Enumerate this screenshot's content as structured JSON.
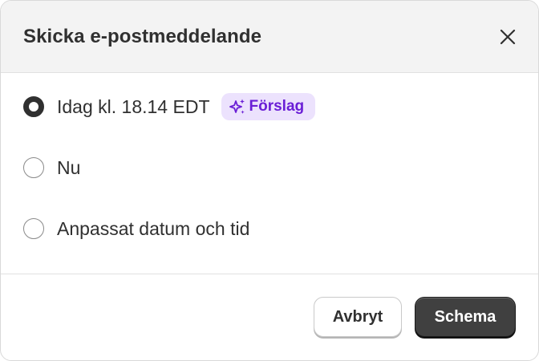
{
  "dialog": {
    "title": "Skicka e-postmeddelande",
    "close_icon": "close-icon"
  },
  "options": [
    {
      "label": "Idag kl. 18.14 EDT",
      "selected": true,
      "badge": {
        "label": "Förslag",
        "icon": "sparkle-icon",
        "color": "#6a1ed6",
        "background": "#ece2fd"
      }
    },
    {
      "label": "Nu",
      "selected": false
    },
    {
      "label": "Anpassat datum och tid",
      "selected": false
    }
  ],
  "footer": {
    "cancel_label": "Avbryt",
    "submit_label": "Schema"
  }
}
